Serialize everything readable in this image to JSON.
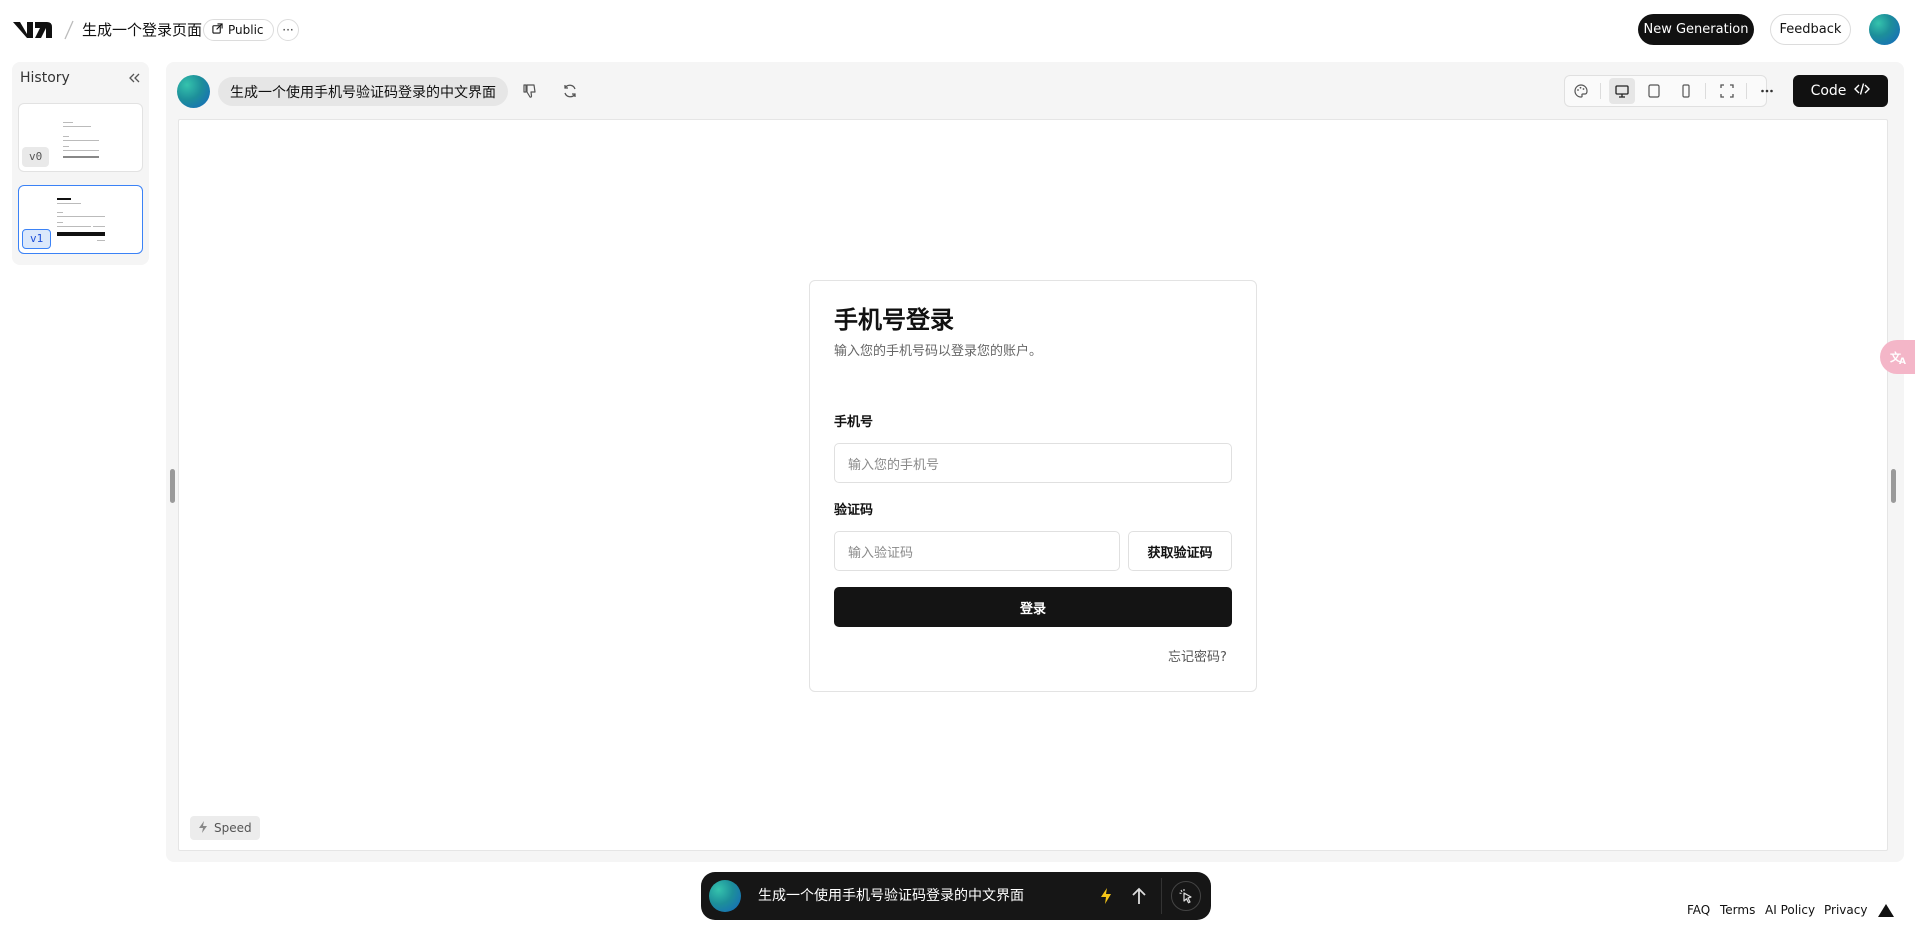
{
  "header": {
    "project_title": "生成一个登录页面",
    "visibility_label": "Public",
    "more_label": "···",
    "new_generation_label": "New Generation",
    "feedback_label": "Feedback"
  },
  "history": {
    "title": "History",
    "versions": [
      {
        "label": "v0",
        "selected": false
      },
      {
        "label": "v1",
        "selected": true
      }
    ]
  },
  "generation": {
    "prompt": "生成一个使用手机号验证码登录的中文界面",
    "code_button_label": "Code"
  },
  "toolbar": {
    "icons": [
      "palette-icon",
      "desktop-icon",
      "tablet-icon",
      "mobile-icon",
      "fullscreen-icon",
      "more-horizontal-icon"
    ],
    "active_view": "desktop"
  },
  "preview": {
    "title": "手机号登录",
    "subtitle": "输入您的手机号码以登录您的账户。",
    "phone_label": "手机号",
    "phone_placeholder": "输入您的手机号",
    "code_label": "验证码",
    "code_placeholder": "输入验证码",
    "get_code_label": "获取验证码",
    "login_label": "登录",
    "forgot_label": "忘记密码?"
  },
  "speed_label": "Speed",
  "chat": {
    "input_value": "生成一个使用手机号验证码登录的中文界面"
  },
  "footer": {
    "links": [
      "FAQ",
      "Terms",
      "AI Policy",
      "Privacy"
    ]
  },
  "colors": {
    "primary": "#111111",
    "panel_bg": "#f5f5f5",
    "selected_border": "#3b82f6"
  }
}
